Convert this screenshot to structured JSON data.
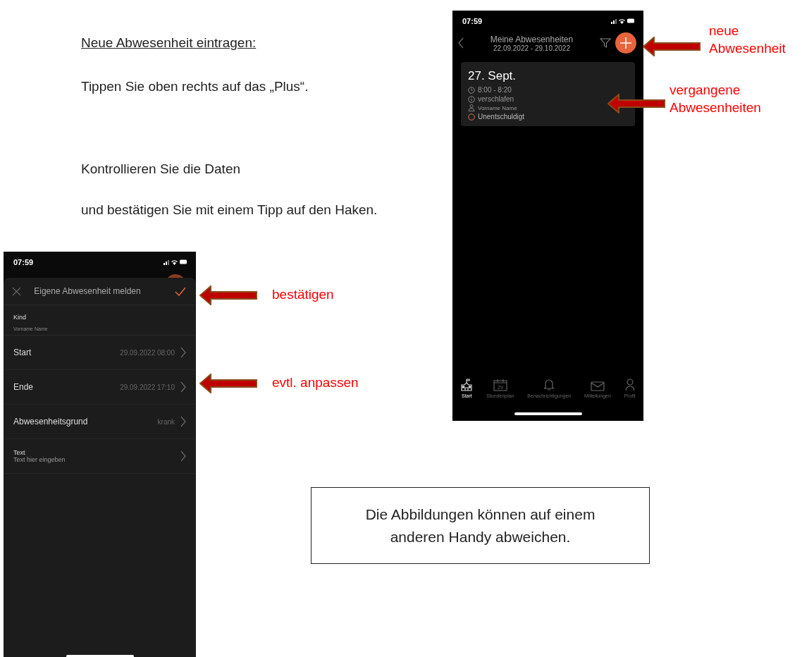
{
  "instructions": {
    "heading": "Neue Abwesenheit eintragen:",
    "step_1": "Tippen Sie oben rechts auf das „Plus“.",
    "step_2": "Kontrollieren Sie die Daten",
    "step_3": "und bestätigen Sie mit einem Tipp auf den Haken."
  },
  "list_screen": {
    "time": "07:59",
    "title": "Meine Abwesenheiten",
    "date_range": "22.09.2022 - 29.10.2022",
    "absences": [
      {
        "date": "27. Sept.",
        "time_span": "8:00 - 8:20",
        "reason": "verschlafen",
        "person": "Vorname Name",
        "status": "Unentschuldigt"
      }
    ],
    "tabs": [
      {
        "label": "Start",
        "selected": true
      },
      {
        "label": "Stundenplan",
        "day": "29",
        "selected": false
      },
      {
        "label": "Benachrichtigungen",
        "selected": false
      },
      {
        "label": "Mitteilungen",
        "selected": false
      },
      {
        "label": "Profil",
        "selected": false
      }
    ]
  },
  "form_screen": {
    "time": "07:59",
    "title": "Eigene Abwesenheit melden",
    "child_label": "Kind",
    "child_value": "Vorname Name",
    "rows": [
      {
        "kind": "value",
        "label": "Start",
        "value": "29.09.2022 08:00"
      },
      {
        "kind": "value",
        "label": "Ende",
        "value": "29.09.2022 17:10"
      },
      {
        "kind": "value",
        "label": "Abwesenheitsgrund",
        "value": "krank"
      },
      {
        "kind": "text",
        "label": "Text",
        "value": "Text hier eingeben"
      }
    ]
  },
  "annotations": [
    {
      "text": "neue\nAbwesenheit"
    },
    {
      "text": "vergangene\nAbwesenheiten"
    },
    {
      "text": "bestätigen"
    },
    {
      "text": "evtl. anpassen"
    }
  ],
  "note": "Die Abbildungen können auf einem anderen Handy abweichen."
}
